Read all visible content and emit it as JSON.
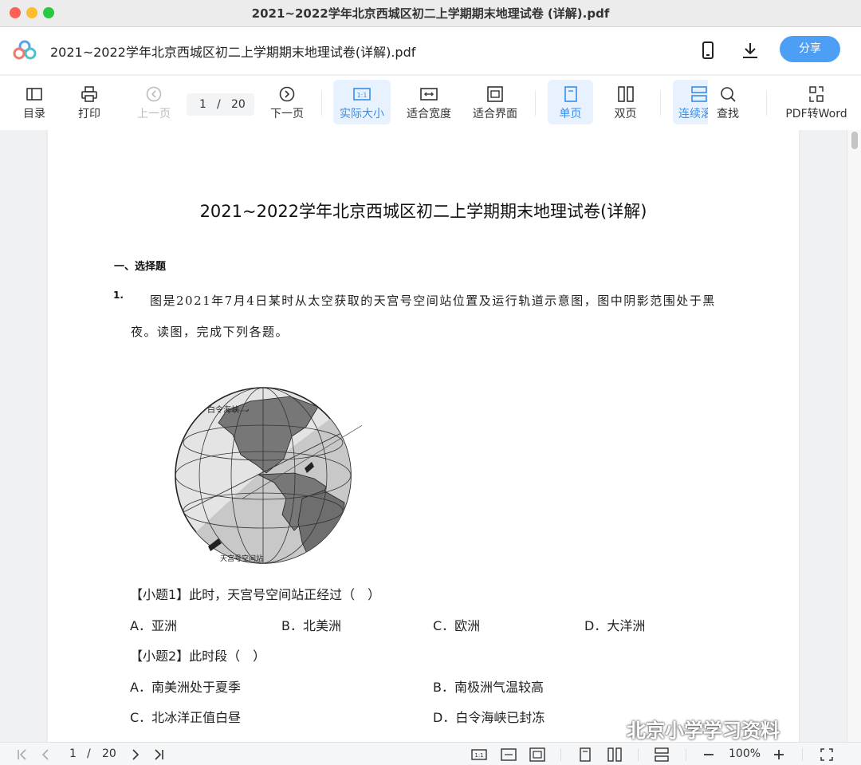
{
  "window": {
    "title": "2021~2022学年北京西城区初二上学期期末地理试卷 (详解).pdf"
  },
  "header": {
    "doc_name": "2021~2022学年北京西城区初二上学期期末地理试卷(详解).pdf",
    "share_label": "分享",
    "icons": [
      "phone-icon",
      "download-icon"
    ]
  },
  "toolbar": {
    "toc": "目录",
    "print": "打印",
    "prev": "上一页",
    "page_current": "1",
    "page_sep": "/",
    "page_total": "20",
    "next": "下一页",
    "actual_size": "实际大小",
    "fit_width": "适合宽度",
    "fit_page": "适合界面",
    "single": "单页",
    "double": "双页",
    "continuous": "连续滚",
    "find": "查找",
    "pdf_to_word": "PDF转Word"
  },
  "page": {
    "title": "2021~2022学年北京西城区初二上学期期末地理试卷(详解)",
    "section": "一、选择题",
    "q_number": "1.",
    "q_line1": "图是2021年7月4日某时从太空获取的天宫号空间站位置及运行轨道示意图，图中阴影范围处于黑",
    "q_line2": "夜。读图，完成下列各题。",
    "map_label_strait": "白令海峡",
    "map_label_station": "天宫号空间站",
    "sub1": "【小题1】此时，天宫号空间站正经过（　）",
    "sub1_options": [
      "A．亚洲",
      "B．北美洲",
      "C．欧洲",
      "D．大洋洲"
    ],
    "sub2": "【小题2】此时段（　）",
    "sub2_options": [
      "A．南美洲处于夏季",
      "B．南极洲气温较高",
      "C．北冰洋正值白昼",
      "D．白令海峡已封冻"
    ]
  },
  "watermark": "北京小学学习资料",
  "bottombar": {
    "page_current": "1",
    "page_sep": "/",
    "page_total": "20",
    "zoom": "100%"
  },
  "colors": {
    "accent": "#3a8ee6",
    "share": "#4d9ff5",
    "active_bg": "#e8f2fe"
  }
}
